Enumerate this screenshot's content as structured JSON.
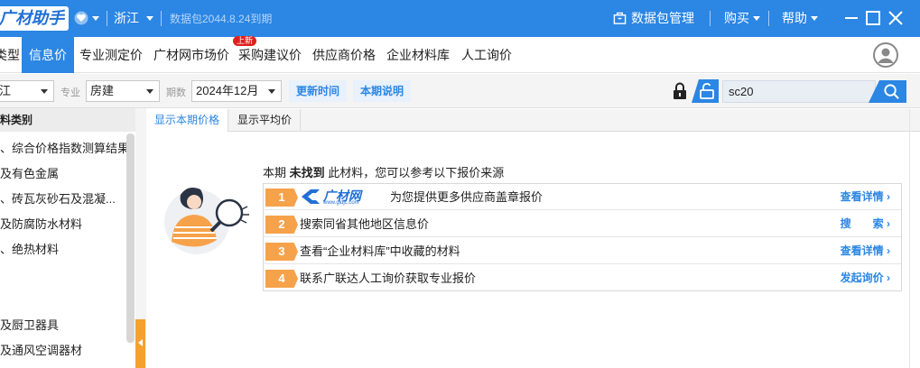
{
  "titlebar": {
    "logo_text": "广材助手",
    "region": "浙江",
    "data_package_expiry": "数据包2044.8.24到期",
    "data_package_mgmt": "数据包管理",
    "buy": "购买",
    "help": "帮助"
  },
  "nav": {
    "items": [
      {
        "label": "类型",
        "active": false
      },
      {
        "label": "信息价",
        "active": true
      },
      {
        "label": "专业测定价",
        "active": false
      },
      {
        "label": "广材网市场价",
        "active": false
      },
      {
        "label": "采购建议价",
        "active": false
      },
      {
        "label": "供应商价格",
        "active": false
      },
      {
        "label": "企业材料库",
        "active": false
      },
      {
        "label": "人工询价",
        "active": false
      }
    ],
    "badge_new": "上新"
  },
  "filters": {
    "region_value": "江",
    "major_label": "专业",
    "major_value": "房建",
    "period_label": "期数",
    "period_value": "2024年12月",
    "update_time_btn": "更新时间",
    "period_note_btn": "本期说明",
    "search_value": "sc20"
  },
  "sidebar": {
    "heading": "料类别",
    "items": [
      "、综合价格指数测算结果",
      "及有色金属",
      "、砖瓦灰砂石及混凝...",
      "及防腐防水材料",
      "、绝热材料",
      "",
      "",
      "及厨卫器具",
      "及通风空调器材"
    ]
  },
  "content": {
    "tabs": [
      {
        "label": "显示本期价格",
        "active": true
      },
      {
        "label": "显示平均价",
        "active": false
      }
    ],
    "notfound_prefix": "本期",
    "notfound_bold": "未找到",
    "notfound_suffix": "此材料，您可以参考以下报价来源",
    "options": [
      {
        "num": "1",
        "logo_text": "广材网",
        "logo_sub": "www.gldjc.com",
        "text": "为您提供更多供应商盖章报价",
        "link": "查看详情",
        "color": "#f6a24a"
      },
      {
        "num": "2",
        "text": "搜索同省其他地区信息价",
        "link": "搜　　索",
        "color": "#f6a24a"
      },
      {
        "num": "3",
        "text": "查看“企业材料库”中收藏的材料",
        "link": "查看详情",
        "color": "#f6a24a"
      },
      {
        "num": "4",
        "text": "联系广联达人工询价获取专业报价",
        "link": "发起询价",
        "color": "#f6a24a"
      }
    ]
  },
  "colors": {
    "accent": "#2b86e4",
    "orange": "#f6a24a"
  }
}
